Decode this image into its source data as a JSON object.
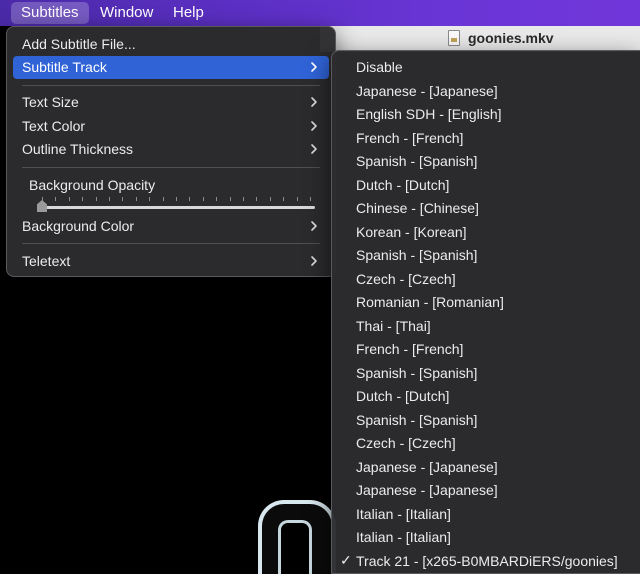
{
  "menubar": {
    "items": [
      "Subtitles",
      "Window",
      "Help"
    ]
  },
  "window": {
    "title": "goonies.mkv"
  },
  "subtitles_menu": {
    "add_file": "Add Subtitle File...",
    "subtitle_track": "Subtitle Track",
    "text_size": "Text Size",
    "text_color": "Text Color",
    "outline_thickness": "Outline Thickness",
    "background_opacity": "Background Opacity",
    "background_opacity_value": 0,
    "background_color": "Background Color",
    "teletext": "Teletext"
  },
  "track_menu": {
    "selected_index": 21,
    "items": [
      "Disable",
      "Japanese - [Japanese]",
      "English SDH - [English]",
      "French - [French]",
      "Spanish - [Spanish]",
      "Dutch - [Dutch]",
      "Chinese - [Chinese]",
      "Korean - [Korean]",
      "Spanish - [Spanish]",
      "Czech - [Czech]",
      "Romanian - [Romanian]",
      "Thai - [Thai]",
      "French - [French]",
      "Spanish - [Spanish]",
      "Dutch - [Dutch]",
      "Spanish - [Spanish]",
      "Czech - [Czech]",
      "Japanese - [Japanese]",
      "Japanese - [Japanese]",
      "Italian - [Italian]",
      "Italian - [Italian]",
      "Track 21 - [x265-B0MBARDiERS/goonies]"
    ],
    "check_mark": "✓"
  },
  "icons": {
    "submenu": "chevron-right-icon",
    "document": "document-icon"
  },
  "colors": {
    "menubar": "#5a2fc2",
    "highlight": "#2f63d6",
    "menu_bg": "#2c2c2f"
  }
}
